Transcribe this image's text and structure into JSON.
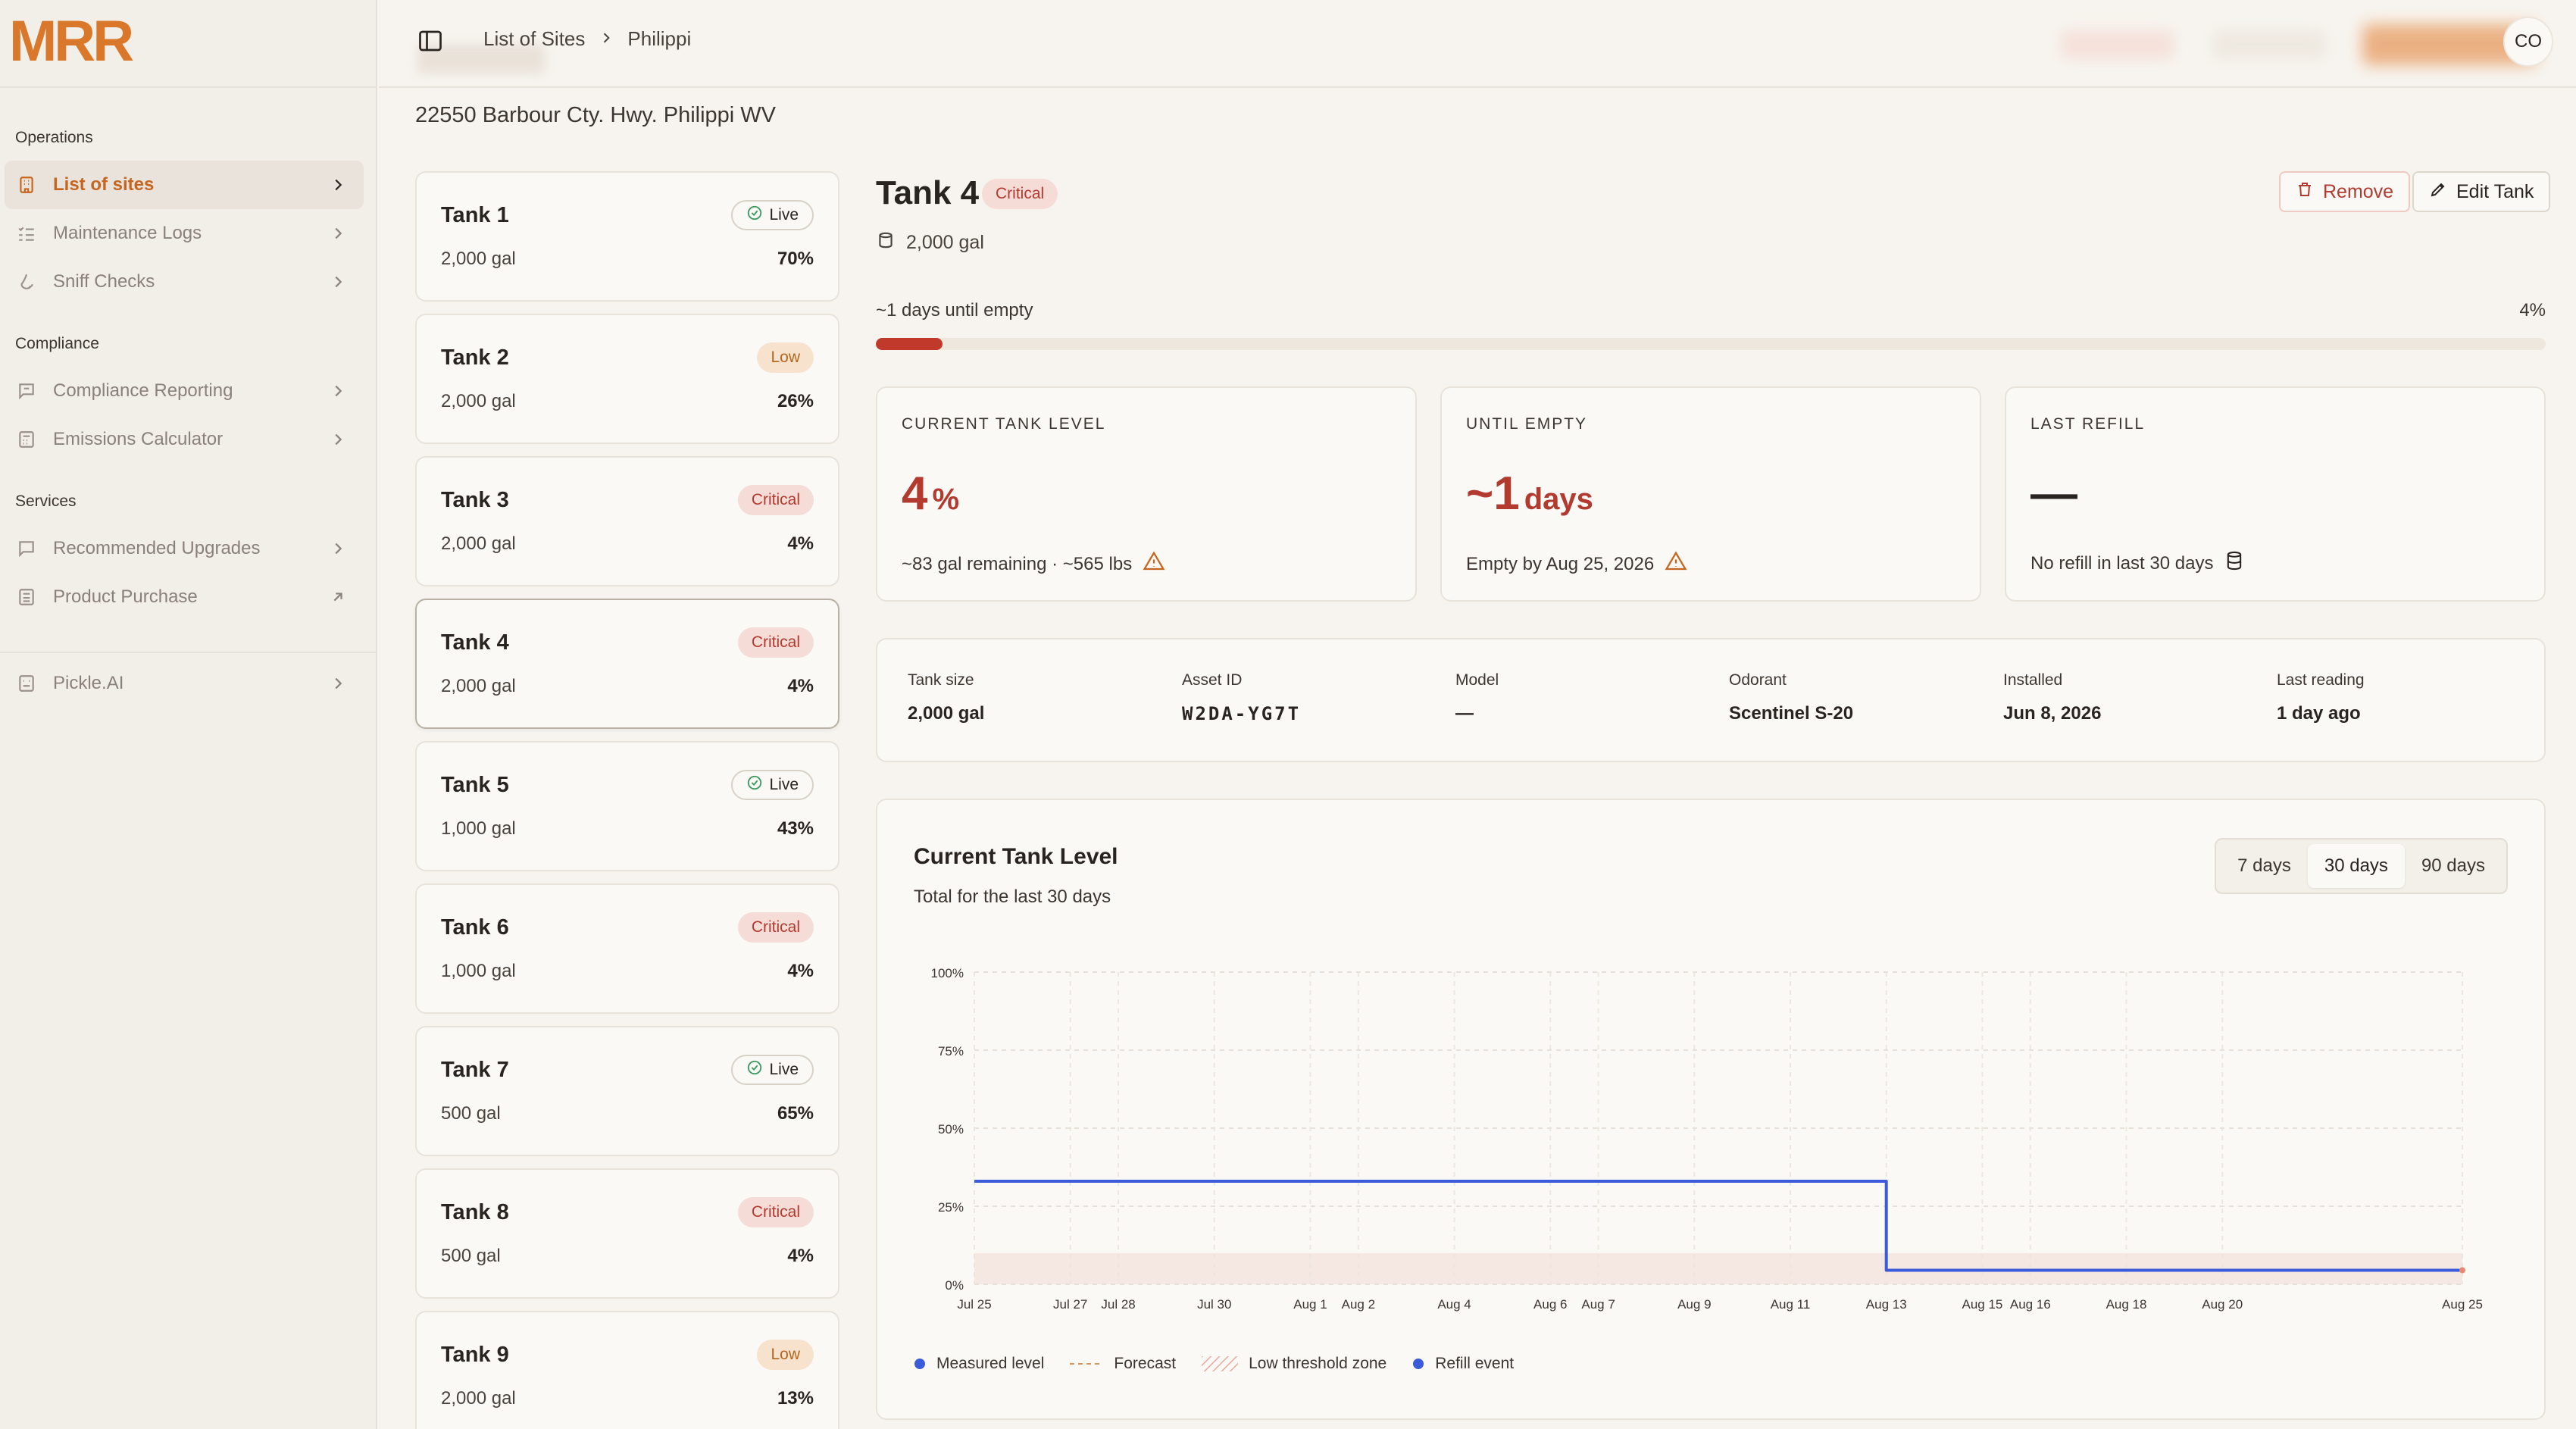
{
  "brand": {
    "logo_text": "MRR",
    "color": "#d9772b"
  },
  "sidebar": {
    "sections": [
      {
        "label": "Operations"
      },
      {
        "label": "Compliance"
      },
      {
        "label": "Services"
      }
    ],
    "items": [
      {
        "label": "List of sites",
        "icon": "building-icon",
        "active": true
      },
      {
        "label": "Maintenance Logs",
        "icon": "list-check-icon"
      },
      {
        "label": "Sniff Checks",
        "icon": "nose-icon"
      },
      {
        "label": "Compliance Reporting",
        "icon": "message-square-icon"
      },
      {
        "label": "Emissions Calculator",
        "icon": "calculator-icon"
      },
      {
        "label": "Recommended Upgrades",
        "icon": "message-square-icon"
      },
      {
        "label": "Product Purchase",
        "icon": "calculator-icon",
        "external": true
      },
      {
        "label": "Pickle.AI",
        "icon": "bot-icon"
      }
    ]
  },
  "header": {
    "breadcrumbs": [
      "List of Sites",
      "Philippi"
    ],
    "avatar_initials": "CO"
  },
  "site": {
    "address": "22550 Barbour Cty. Hwy. Philippi WV"
  },
  "tanks": [
    {
      "name": "Tank 1",
      "capacity": "2,000 gal",
      "level": "70%",
      "status": "Live",
      "status_kind": "live"
    },
    {
      "name": "Tank 2",
      "capacity": "2,000 gal",
      "level": "26%",
      "status": "Low",
      "status_kind": "low"
    },
    {
      "name": "Tank 3",
      "capacity": "2,000 gal",
      "level": "4%",
      "status": "Critical",
      "status_kind": "critical"
    },
    {
      "name": "Tank 4",
      "capacity": "2,000 gal",
      "level": "4%",
      "status": "Critical",
      "status_kind": "critical",
      "selected": true
    },
    {
      "name": "Tank 5",
      "capacity": "1,000 gal",
      "level": "43%",
      "status": "Live",
      "status_kind": "live"
    },
    {
      "name": "Tank 6",
      "capacity": "1,000 gal",
      "level": "4%",
      "status": "Critical",
      "status_kind": "critical"
    },
    {
      "name": "Tank 7",
      "capacity": "500 gal",
      "level": "65%",
      "status": "Live",
      "status_kind": "live"
    },
    {
      "name": "Tank 8",
      "capacity": "500 gal",
      "level": "4%",
      "status": "Critical",
      "status_kind": "critical"
    },
    {
      "name": "Tank 9",
      "capacity": "2,000 gal",
      "level": "13%",
      "status": "Low",
      "status_kind": "low"
    }
  ],
  "detail": {
    "title": "Tank 4",
    "status": "Critical",
    "capacity": "2,000 gal",
    "remove_label": "Remove",
    "edit_label": "Edit Tank",
    "until_empty_text": "~1 days until empty",
    "level_text": "4%",
    "level_fraction": 0.04,
    "stats": {
      "current": {
        "label": "CURRENT TANK LEVEL",
        "value": "4",
        "unit": "%",
        "note": "~83 gal remaining · ~565 lbs"
      },
      "until": {
        "label": "UNTIL EMPTY",
        "value": "~1",
        "unit": "days",
        "note": "Empty by Aug 25, 2026"
      },
      "refill": {
        "label": "LAST REFILL",
        "value": "—",
        "note": "No refill in last 30 days"
      }
    },
    "info": [
      {
        "label": "Tank size",
        "value": "2,000 gal"
      },
      {
        "label": "Asset ID",
        "value": "W2DA-YG7T"
      },
      {
        "label": "Model",
        "value": "—"
      },
      {
        "label": "Odorant",
        "value": "Scentinel S-20"
      },
      {
        "label": "Installed",
        "value": "Jun 8, 2026"
      },
      {
        "label": "Last reading",
        "value": "1 day ago"
      }
    ]
  },
  "chart": {
    "title": "Current Tank Level",
    "subtitle": "Total for the last 30 days",
    "ranges": [
      "7 days",
      "30 days",
      "90 days"
    ],
    "active_range": "30 days",
    "legend": [
      "Measured level",
      "Forecast",
      "Low threshold zone",
      "Refill event"
    ]
  },
  "chart_data": {
    "type": "line",
    "title": "Current Tank Level",
    "subtitle": "Total for the last 30 days",
    "y_ticks": [
      "0%",
      "25%",
      "50%",
      "75%",
      "100%"
    ],
    "ylim": [
      0,
      100
    ],
    "x_ticks": [
      "Jul 25",
      "Jul 27",
      "Jul 28",
      "Jul 30",
      "Aug 1",
      "Aug 2",
      "Aug 4",
      "Aug 6",
      "Aug 7",
      "Aug 9",
      "Aug 11",
      "Aug 13",
      "Aug 15",
      "Aug 16",
      "Aug 18",
      "Aug 20",
      "Aug 25"
    ],
    "xlim": [
      "Jul 25",
      "Aug 25"
    ],
    "low_threshold_zone": [
      0,
      10
    ],
    "series": [
      {
        "name": "Measured level",
        "color": "#3b5bdb",
        "points": [
          {
            "x": "Jul 25",
            "y": 33
          },
          {
            "x": "Aug 13",
            "y": 33
          },
          {
            "x": "Aug 13",
            "y": 4.5
          },
          {
            "x": "Aug 25",
            "y": 4.5
          }
        ]
      }
    ],
    "grid": true,
    "legend_position": "bottom-left"
  }
}
